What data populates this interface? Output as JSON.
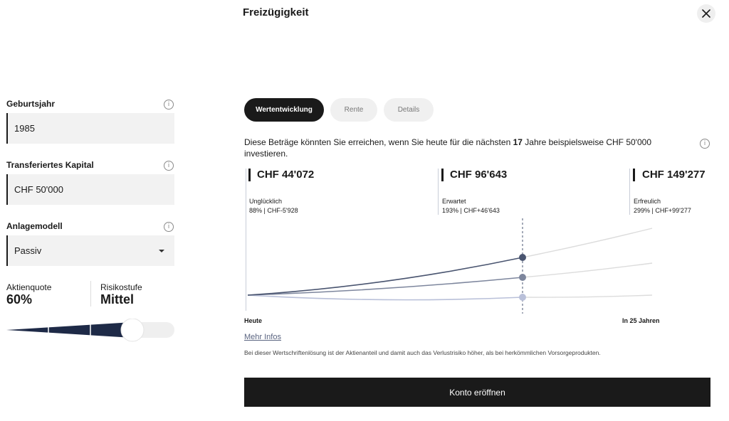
{
  "header": {
    "title": "Freizügigkeit",
    "close_icon": "close-icon"
  },
  "form": {
    "birth_year": {
      "label": "Geburtsjahr",
      "value": "1985"
    },
    "capital": {
      "label": "Transferiertes Kapital",
      "value": "CHF 50'000"
    },
    "model": {
      "label": "Anlagemodell",
      "value": "Passiv"
    },
    "equity": {
      "label": "Aktienquote",
      "value": "60%"
    },
    "risk": {
      "label": "Risikostufe",
      "value": "Mittel"
    },
    "slider": {
      "level": 0.6
    }
  },
  "tabs": [
    {
      "label": "Wertentwicklung",
      "active": true
    },
    {
      "label": "Rente",
      "active": false
    },
    {
      "label": "Details",
      "active": false
    }
  ],
  "intro": {
    "before": "Diese Beträge könnten Sie erreichen, wenn Sie heute für die nächsten ",
    "years": "17",
    "after": " Jahre beispielsweise CHF 50'000 investieren."
  },
  "scenarios": [
    {
      "value": "CHF 44'072",
      "name": "Unglücklich",
      "detail": "88% | CHF-5'928"
    },
    {
      "value": "CHF 96'643",
      "name": "Erwartet",
      "detail": "193% | CHF+46'643"
    },
    {
      "value": "CHF 149'277",
      "name": "Erfreulich",
      "detail": "299% | CHF+99'277"
    }
  ],
  "chart_data": {
    "type": "line",
    "x_start_label": "Heute",
    "x_end_label": "In 25 Jahren",
    "marker_year": 17,
    "total_years": 25,
    "colors": {
      "high": "#4a5570",
      "mid": "#7d869d",
      "low": "#b9c0d9"
    }
  },
  "more_info": "Mehr Infos",
  "disclaimer": "Bei dieser Wertschriftenlösung ist der Aktienanteil und damit auch das Verlustrisiko höher, als bei herkömmlichen Vorsorgeprodukten.",
  "cta": "Konto eröffnen"
}
